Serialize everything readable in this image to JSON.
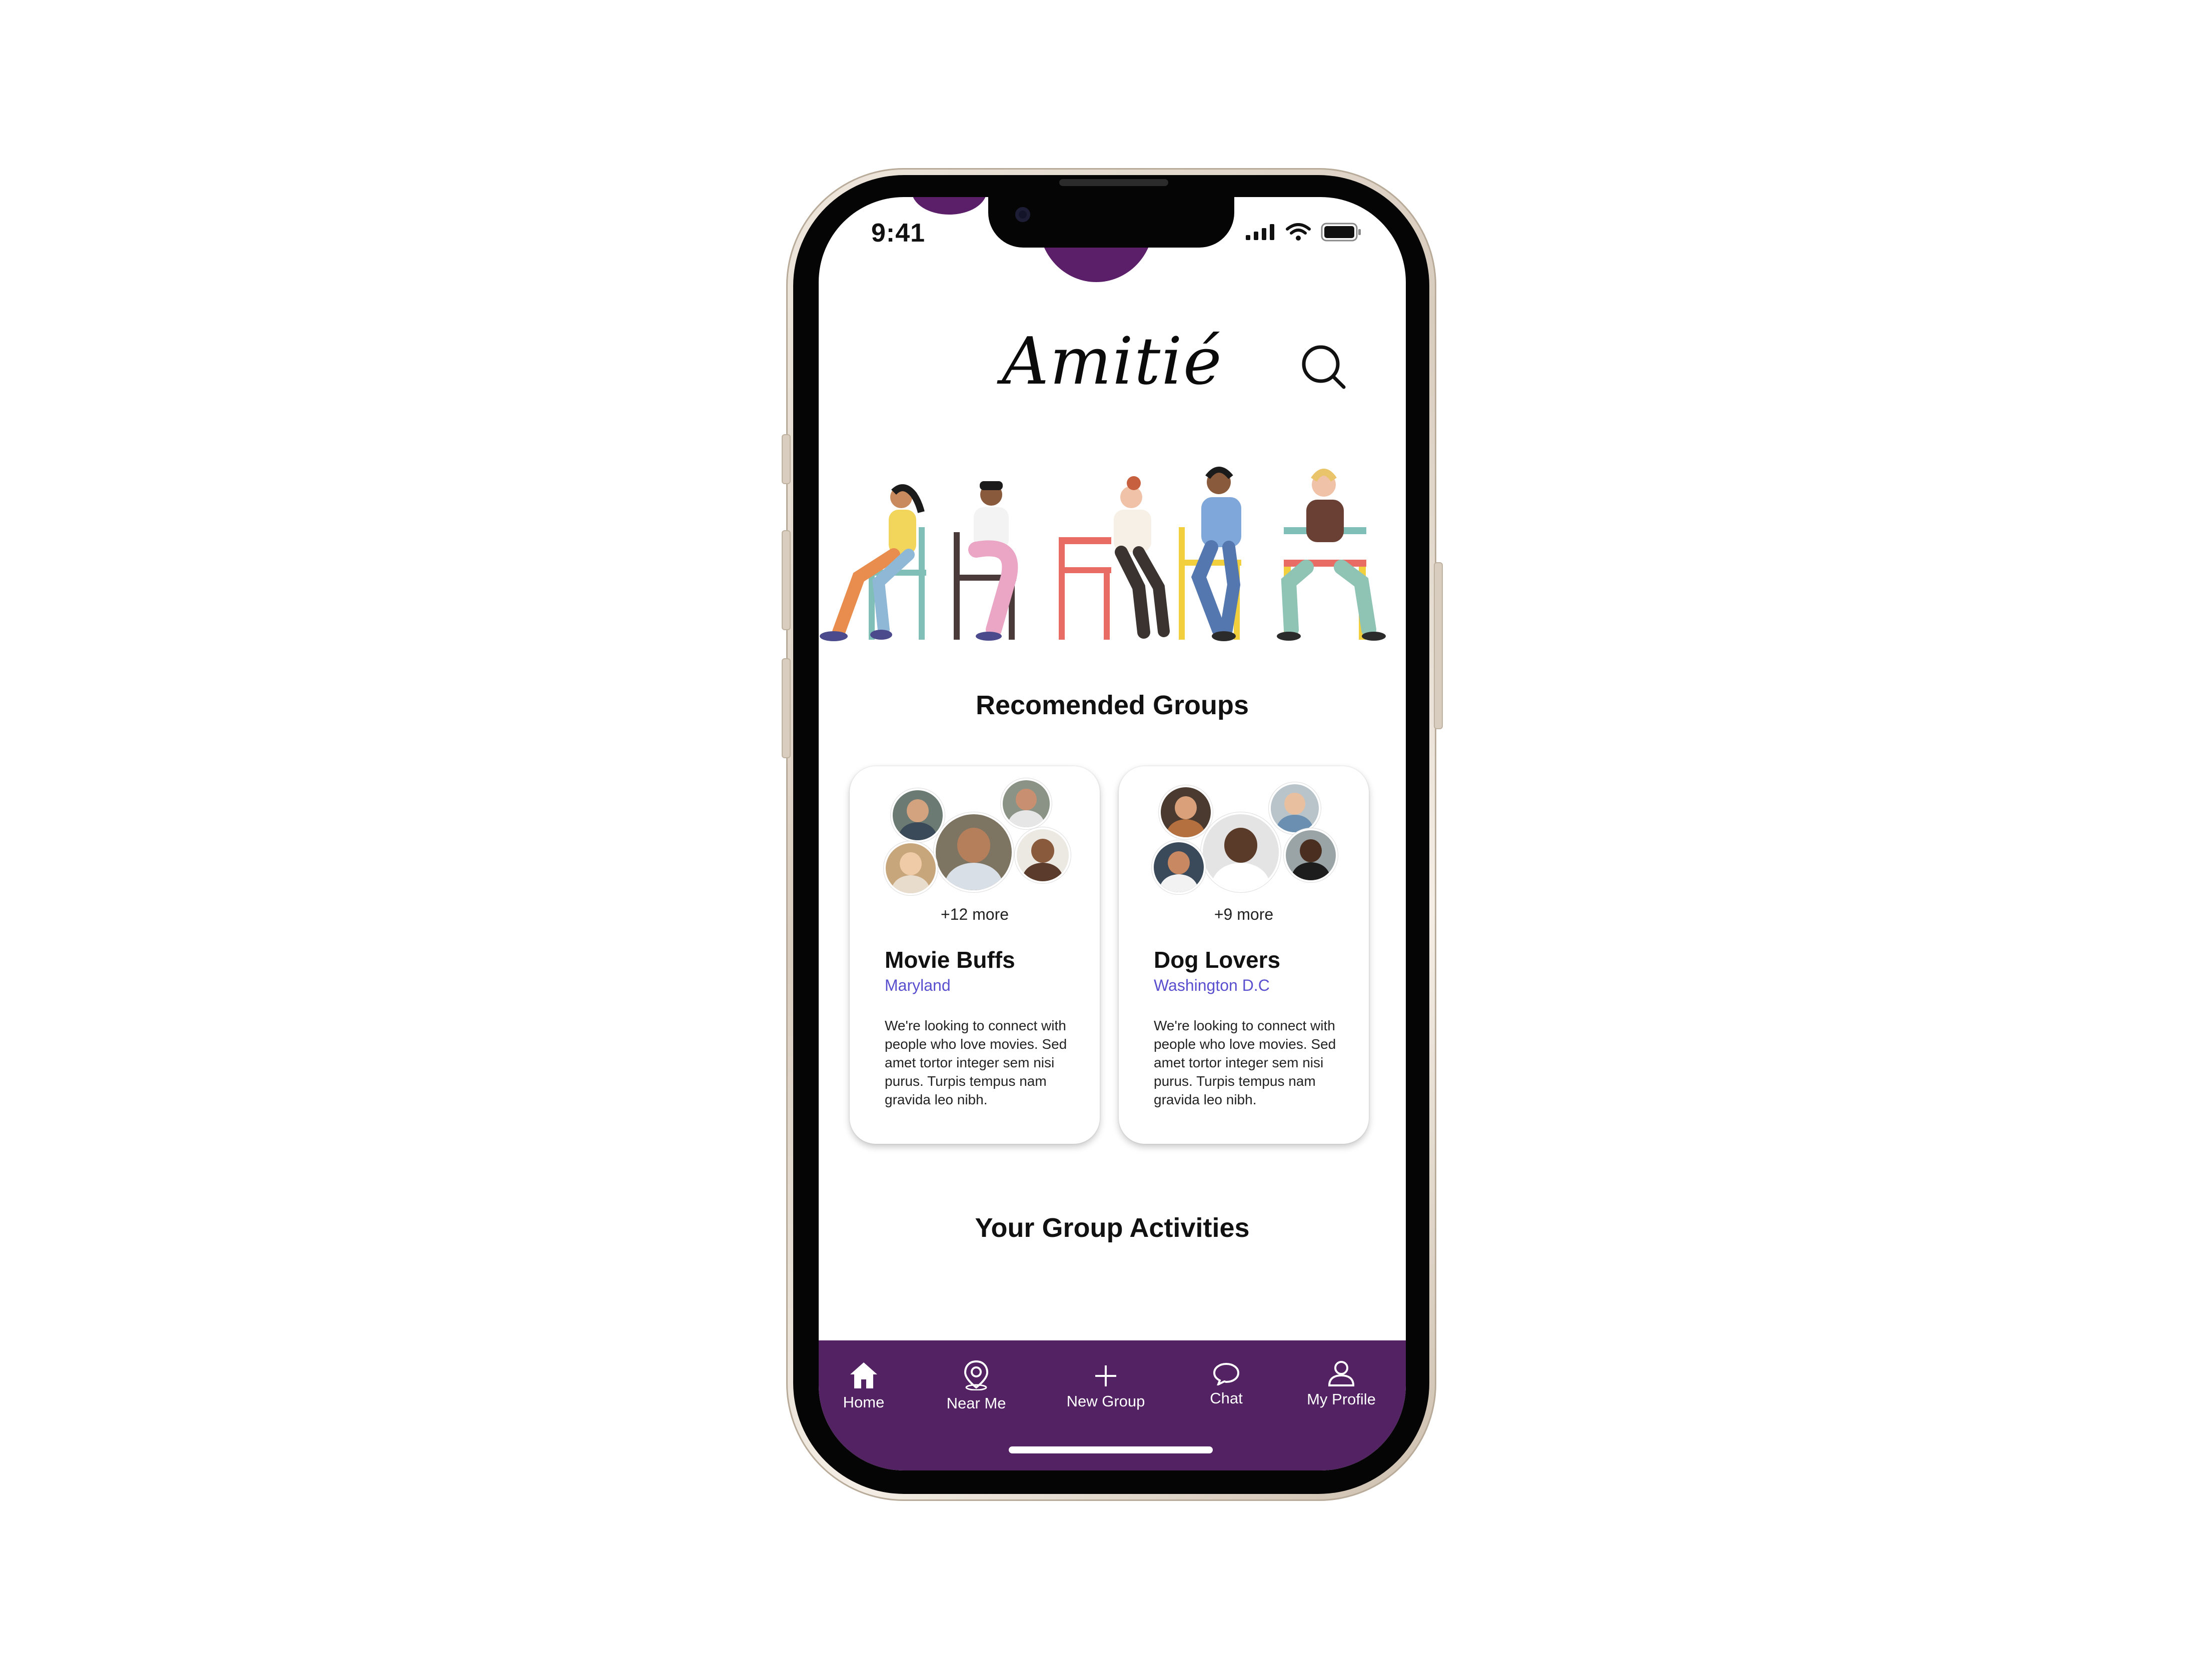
{
  "status_bar": {
    "time": "9:41"
  },
  "app": {
    "logo": "Amitié"
  },
  "recommended": {
    "title": "Recomended Groups",
    "groups": [
      {
        "more": "+12 more",
        "name": "Movie Buffs",
        "location": "Maryland",
        "description": "We're looking to connect with people who love movies. Sed amet tortor integer sem nisi purus. Turpis tempus nam gravida leo nibh."
      },
      {
        "more": "+9 more",
        "name": "Dog Lovers",
        "location": "Washington D.C",
        "description": "We're looking to connect with people who love movies. Sed amet tortor integer sem nisi purus. Turpis tempus nam gravida leo nibh."
      }
    ]
  },
  "activities": {
    "title": "Your Group Activities"
  },
  "nav": [
    {
      "label": "Home",
      "icon": "home-icon"
    },
    {
      "label": "Near Me",
      "icon": "location-pin-icon"
    },
    {
      "label": "New Group",
      "icon": "plus-icon"
    },
    {
      "label": "Chat",
      "icon": "chat-bubble-icon"
    },
    {
      "label": "My Profile",
      "icon": "user-icon"
    }
  ],
  "colors": {
    "brand_purple": "#522262",
    "location_blue": "#5a4fcf"
  }
}
